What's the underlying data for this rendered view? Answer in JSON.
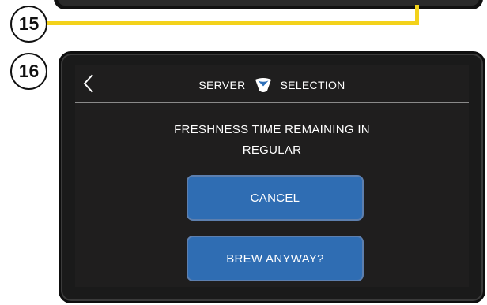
{
  "steps": {
    "previous_number": "15",
    "current_number": "16"
  },
  "header": {
    "title_left": "SERVER",
    "title_right": "SELECTION",
    "center_icon": "server-cup-icon",
    "back_icon": "chevron-left-icon"
  },
  "message": {
    "line1": "FRESHNESS TIME REMAINING IN",
    "line2": "REGULAR"
  },
  "buttons": {
    "cancel_label": "CANCEL",
    "brew_anyway_label": "BREW ANYWAY?"
  },
  "colors": {
    "connector": "#f3d21b",
    "button_fill": "#2f6db3",
    "screen_bg": "#1f1e1e",
    "icon_blue": "#2e6fb8"
  }
}
